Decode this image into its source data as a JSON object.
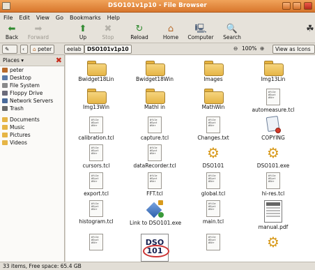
{
  "window": {
    "title": "DSO101v1p10 - File Browser"
  },
  "menu": [
    "File",
    "Edit",
    "View",
    "Go",
    "Bookmarks",
    "Help"
  ],
  "toolbar": {
    "back": "Back",
    "forward": "Forward",
    "up": "Up",
    "stop": "Stop",
    "reload": "Reload",
    "home": "Home",
    "computer": "Computer",
    "search": "Search"
  },
  "location": {
    "crumbs": [
      "peter",
      "eelab",
      "DSO101v1p10"
    ],
    "zoom": "100%",
    "view": "View as Icons"
  },
  "sidebar": {
    "header": "Places",
    "items": [
      {
        "label": "peter",
        "icon": "home-icon"
      },
      {
        "label": "Desktop",
        "icon": "desktop-icon"
      },
      {
        "label": "File System",
        "icon": "drive-icon"
      },
      {
        "label": "Floppy Drive",
        "icon": "floppy-icon"
      },
      {
        "label": "Network Servers",
        "icon": "network-icon"
      },
      {
        "label": "Trash",
        "icon": "trash-icon"
      }
    ],
    "bookmarks": [
      {
        "label": "Documents",
        "icon": "folder-icon"
      },
      {
        "label": "Music",
        "icon": "folder-icon"
      },
      {
        "label": "Pictures",
        "icon": "folder-icon"
      },
      {
        "label": "Videos",
        "icon": "folder-icon"
      }
    ]
  },
  "files": [
    {
      "name": "Bwidget18Lin",
      "kind": "folder"
    },
    {
      "name": "Bwidget18Win",
      "kind": "folder"
    },
    {
      "name": "Images",
      "kind": "folder"
    },
    {
      "name": "Img13Lin",
      "kind": "folder"
    },
    {
      "name": "Img13Win",
      "kind": "folder"
    },
    {
      "name": "Mathl in",
      "kind": "folder"
    },
    {
      "name": "MathWin",
      "kind": "folder"
    },
    {
      "name": "automeasure.tcl",
      "kind": "script"
    },
    {
      "name": "calibration.tcl",
      "kind": "script"
    },
    {
      "name": "capture.tcl",
      "kind": "script"
    },
    {
      "name": "Changes.txt",
      "kind": "script"
    },
    {
      "name": "COPYING",
      "kind": "copy"
    },
    {
      "name": "cursors.tcl",
      "kind": "script"
    },
    {
      "name": "dataRecorder.tcl",
      "kind": "script"
    },
    {
      "name": "DSO101",
      "kind": "gear"
    },
    {
      "name": "DSO101.exe",
      "kind": "gear"
    },
    {
      "name": "export.tcl",
      "kind": "script"
    },
    {
      "name": "FFT.tcl",
      "kind": "script"
    },
    {
      "name": "global.tcl",
      "kind": "script"
    },
    {
      "name": "hi-res.tcl",
      "kind": "script"
    },
    {
      "name": "histogram.tcl",
      "kind": "script"
    },
    {
      "name": "Link to DSO101.exe",
      "kind": "link"
    },
    {
      "name": "main.tcl",
      "kind": "script"
    },
    {
      "name": "manual.pdf",
      "kind": "pdf"
    },
    {
      "name": "",
      "kind": "script"
    },
    {
      "name": "",
      "kind": "dso",
      "thumb_text": "DSO 101"
    },
    {
      "name": "",
      "kind": "script"
    },
    {
      "name": "",
      "kind": "gear"
    }
  ],
  "script_preview": "#file\n#Syst\n#Ver",
  "status": "33 items, Free space: 65.4 GB",
  "colors": {
    "titlebar": "#e8894a",
    "folder": "#f0c866",
    "accent_close": "#c62b1b"
  }
}
